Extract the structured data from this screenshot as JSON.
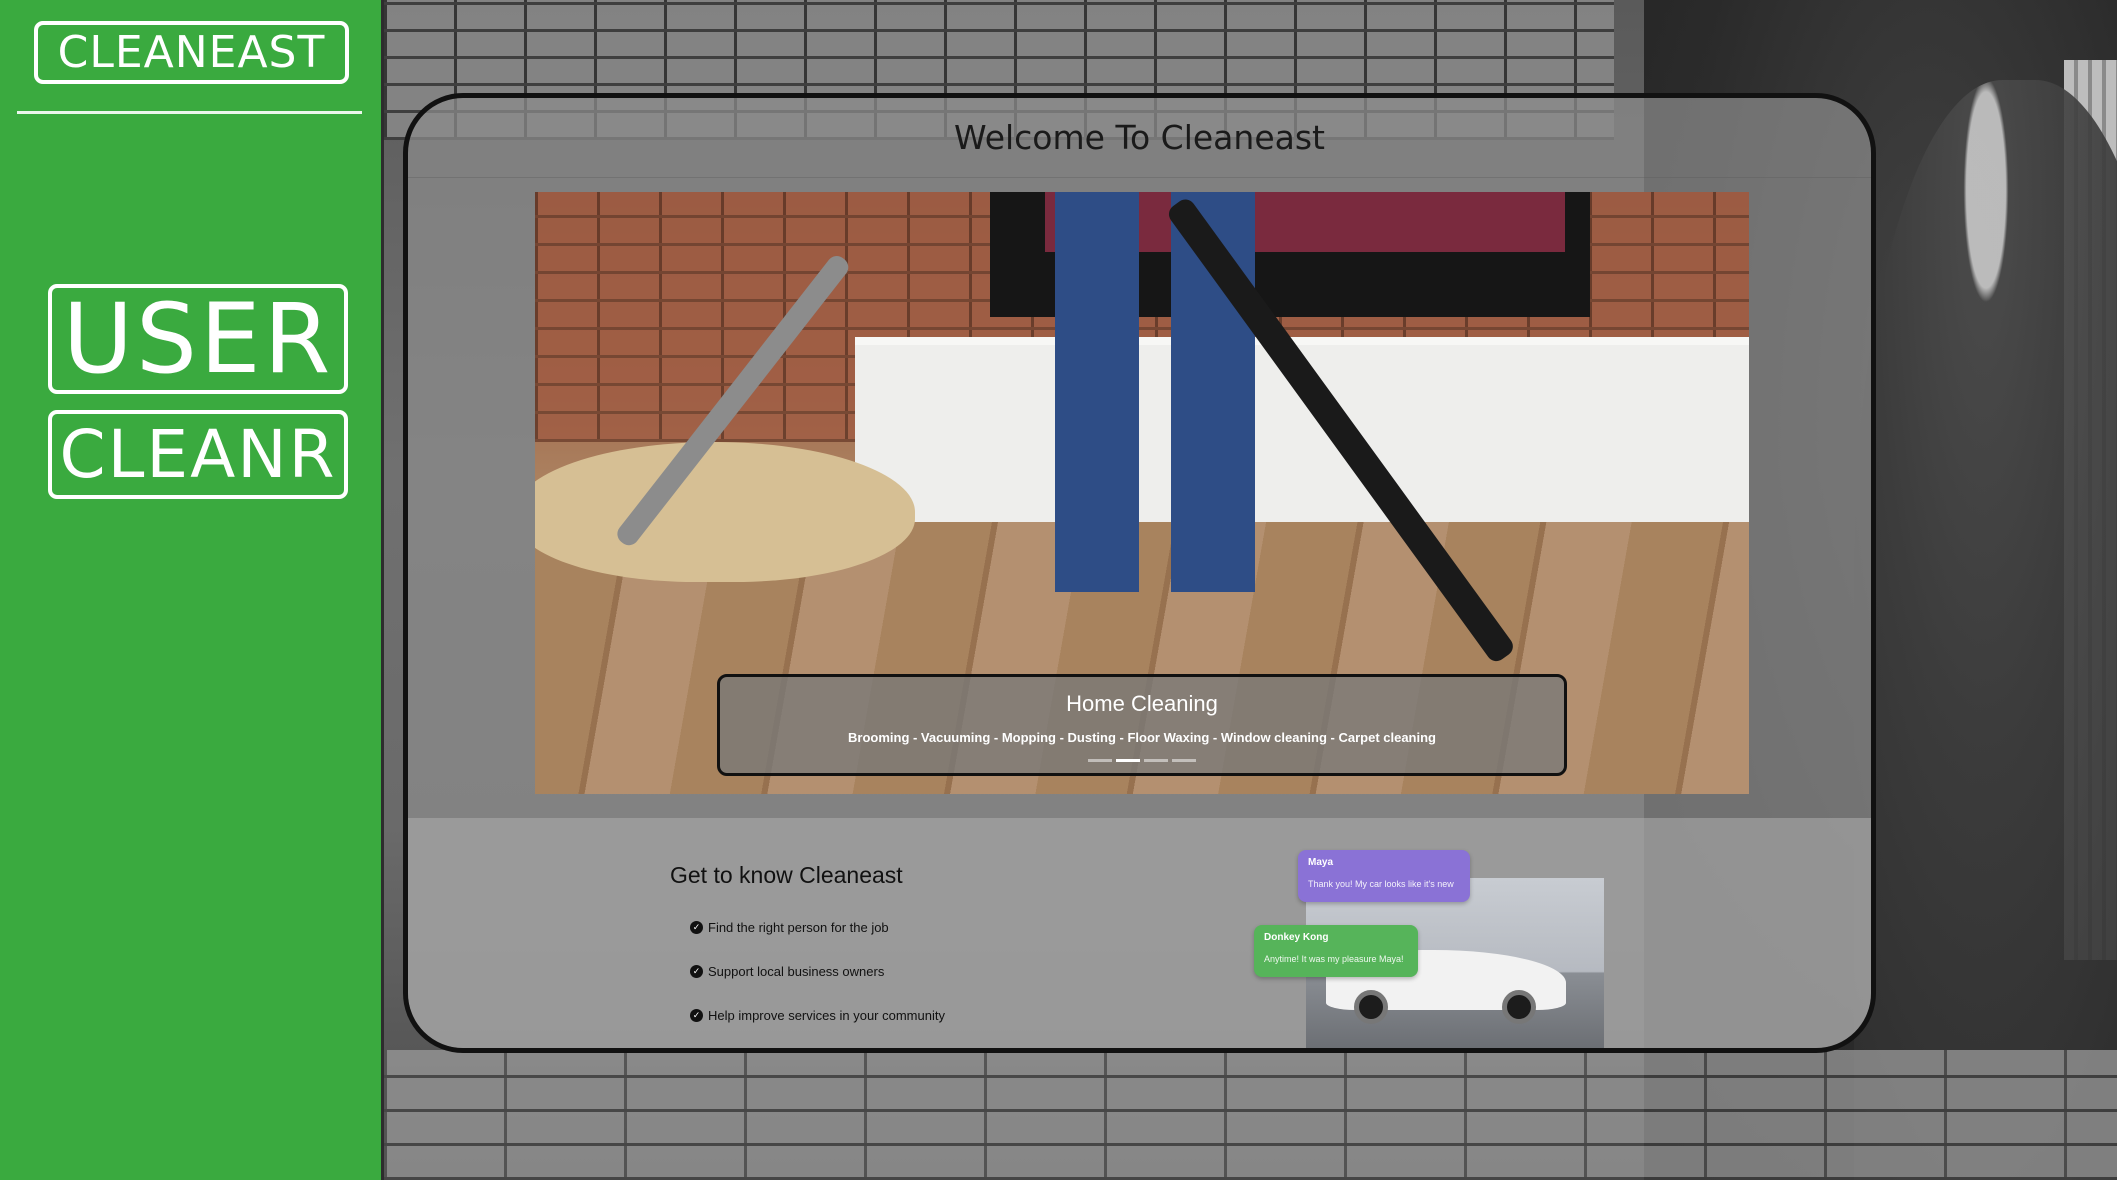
{
  "sidebar": {
    "brand": "CLEANEAST",
    "roles": [
      "USER",
      "CLEANR"
    ]
  },
  "panel": {
    "welcome_title": "Welcome To Cleaneast",
    "carousel": {
      "slide_title": "Home Cleaning",
      "slide_text": "Brooming - Vacuuming - Mopping - Dusting - Floor Waxing - Window cleaning - Carpet cleaning",
      "slide_count": 4,
      "active_index": 1
    },
    "about": {
      "title": "Get to know Cleaneast",
      "features": [
        "Find the right person for the job",
        "Support local business owners",
        "Help improve services in your community"
      ]
    },
    "chat_preview": [
      {
        "name": "Maya",
        "message": "Thank you! My car looks like it's new",
        "color": "#8a72d6"
      },
      {
        "name": "Donkey Kong",
        "message": "Anytime! It was my pleasure Maya!",
        "color": "#56b45a"
      }
    ]
  },
  "colors": {
    "sidebar_green": "#3aaa3f",
    "panel_border": "#111111"
  },
  "icons": {
    "feature_bullet": "check-circle-icon"
  }
}
